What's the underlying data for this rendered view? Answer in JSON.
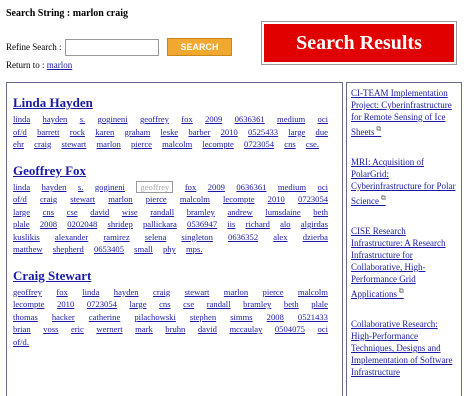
{
  "header": {
    "search_string": "Search String : marlon craig",
    "refine_label": "Refine Search :",
    "refine_value": "",
    "search_button": "SEARCH",
    "return_label": "Return to :",
    "return_link": "marlon",
    "banner": "Search Results"
  },
  "results": [
    {
      "name": "Linda Hayden",
      "tags": [
        "linda",
        "hayden",
        "s.",
        "gogineni",
        "geoffrey",
        "fox",
        "2009",
        "0636361",
        "medium",
        "oci",
        "of/d",
        "barrett",
        "rock",
        "karen",
        "graham",
        "leske",
        "barber",
        "2010",
        "0525433",
        "large",
        "due",
        "ehr",
        "craig",
        "stewart",
        "marlon",
        "pierce",
        "malcolm",
        "lecompte",
        "0723054",
        "cns",
        "cse."
      ]
    },
    {
      "name": "Geoffrey Fox",
      "tags": [
        "linda",
        "hayden",
        "s.",
        "gogineni",
        "geoffrey",
        "fox",
        "2009",
        "0636361",
        "medium",
        "oci",
        "of/d",
        "craig",
        "stewart",
        "marlon",
        "pierce",
        "malcolm",
        "lecompte",
        "2010",
        "0723054",
        "large",
        "cns",
        "cse",
        "david",
        "wise",
        "randall",
        "bramley",
        "andrew",
        "lumsdaine",
        "beth",
        "plale",
        "2008",
        "0202048",
        "shridep",
        "pallickara",
        "0536947",
        "iis",
        "richard",
        "alo",
        "algirdas",
        "kuslikis",
        "alexander",
        "ramirez",
        "selena",
        "singleton",
        "0636352",
        "alex",
        "dzierba",
        "matthew",
        "shepherd",
        "0653405",
        "small",
        "phy",
        "mps."
      ]
    },
    {
      "name": "Craig Stewart",
      "tags": [
        "geoffrey",
        "fox",
        "linda",
        "hayden",
        "craig",
        "stewart",
        "marlon",
        "pierce",
        "malcolm",
        "lecompte",
        "2010",
        "0723054",
        "large",
        "cns",
        "cse",
        "randall",
        "bramley",
        "beth",
        "plale",
        "thomas",
        "hacker",
        "catherine",
        "pilachowski",
        "stephen",
        "simms",
        "2008",
        "0521433",
        "brian",
        "voss",
        "eric",
        "wernert",
        "mark",
        "bruhn",
        "david",
        "mccaulay",
        "0504075",
        "oci",
        "of/d."
      ]
    }
  ],
  "sidebar": {
    "items": [
      "CI-TEAM Implementation Project: Cyberinfrastructure for Remote Sensing of Ice Sheets",
      "MRI: Acquisition of PolarGrid: Cyberinfrastructure for Polar Science",
      "CISE Research Infrastructure: A Research Infrastructure for Collaborative, High-Performance Grid Applications",
      "Collaborative Research: High-Performance Techniques, Designs and Implementation of Software Infrastructure"
    ],
    "ext_glyph": "⧉"
  },
  "highlighted_tag": "geoffrey"
}
